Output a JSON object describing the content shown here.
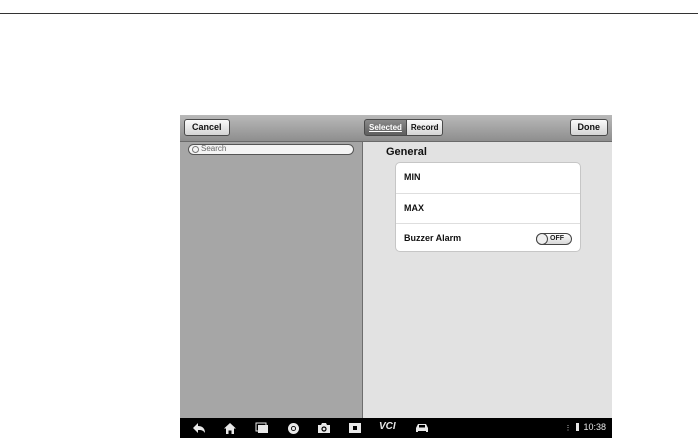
{
  "toolbar": {
    "cancel_label": "Cancel",
    "segments": [
      {
        "label": "Selected",
        "selected": true
      },
      {
        "label": "Record",
        "selected": false
      }
    ],
    "done_label": "Done"
  },
  "left_panel": {
    "search_placeholder": "Search"
  },
  "right_panel": {
    "section_title": "General",
    "rows": [
      {
        "label": "MIN"
      },
      {
        "label": "MAX"
      },
      {
        "label": "Buzzer Alarm",
        "toggle": "OFF"
      }
    ]
  },
  "navbar": {
    "icons": [
      "back-icon",
      "home-icon",
      "recent-apps-icon",
      "browser-icon",
      "camera-icon",
      "screen-capture-icon",
      "vci-icon",
      "car-icon"
    ],
    "vci_label": "VCI",
    "status_time": "10:38"
  },
  "colors": {
    "toolbar": "#a3a3a3",
    "left_panel": "#a6a6a6",
    "right_panel": "#e2e2e2",
    "navbar": "#000000"
  }
}
